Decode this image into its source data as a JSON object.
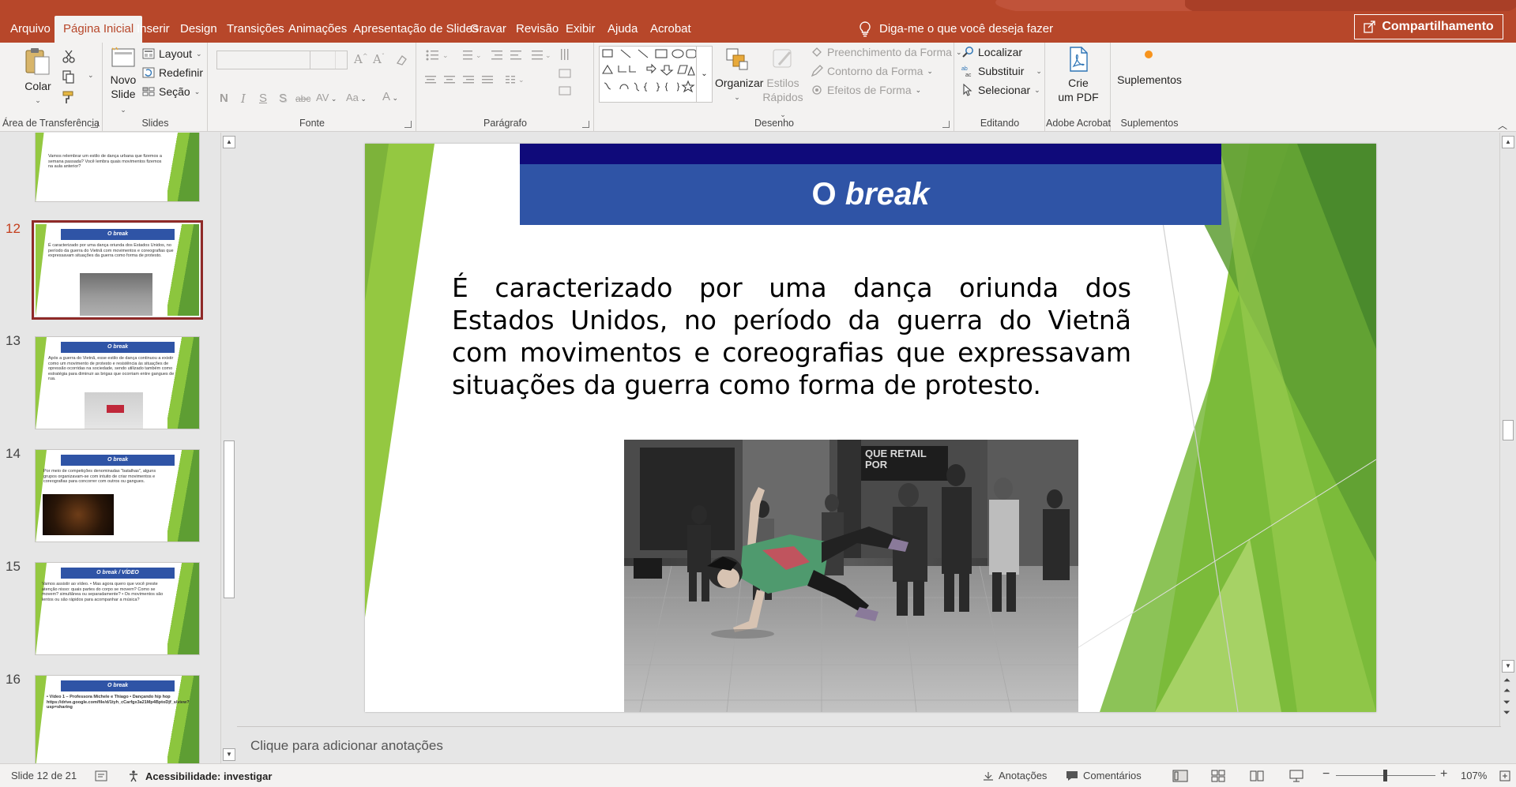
{
  "ribbon_tabs": [
    "Arquivo",
    "Página Inicial",
    "Inserir",
    "Design",
    "Transições",
    "Animações",
    "Apresentação de Slides",
    "Gravar",
    "Revisão",
    "Exibir",
    "Ajuda",
    "Acrobat"
  ],
  "active_tab": "Página Inicial",
  "tell_me": "Diga-me o que você deseja fazer",
  "share_label": "Compartilhamento",
  "groups": {
    "clipboard": {
      "label": "Área de Transferência",
      "paste": "Colar"
    },
    "slides": {
      "label": "Slides",
      "new_slide_line1": "Novo",
      "new_slide_line2": "Slide",
      "layout": "Layout",
      "reset": "Redefinir",
      "section": "Seção"
    },
    "font": {
      "label": "Fonte",
      "bold": "N",
      "italic": "I",
      "underline": "S",
      "shadow": "S",
      "strike": "abc",
      "spacing": "AV",
      "case": "Aa",
      "color": "A"
    },
    "paragraph": {
      "label": "Parágrafo"
    },
    "drawing": {
      "label": "Desenho",
      "organize": "Organizar",
      "quick_styles_line1": "Estilos",
      "quick_styles_line2": "Rápidos",
      "shape_fill": "Preenchimento da Forma",
      "shape_outline": "Contorno da Forma",
      "shape_effects": "Efeitos de Forma"
    },
    "editing": {
      "label": "Editando",
      "find": "Localizar",
      "replace": "Substituir",
      "select": "Selecionar"
    },
    "acrobat": {
      "label": "Adobe Acrobat",
      "create_line1": "Crie",
      "create_line2": "um PDF"
    },
    "addins": {
      "label": "Suplementos",
      "addins": "Suplementos"
    }
  },
  "thumbnails": [
    {
      "num": "",
      "title": "",
      "text": "Vamos relembrar um estilo de dança urbana que fizemos a semana passada? Você lembra quais movimentos fizemos na aula anterior?"
    },
    {
      "num": "12",
      "title": "O break",
      "text": "É caracterizado por uma dança oriunda dos Estados Unidos, no período da guerra do Vietnã com movimentos e coreografias que expressavam situações da guerra como forma de protesto."
    },
    {
      "num": "13",
      "title": "O break",
      "text": "Após a guerra do Vietnã, esse estilo de dança continuou a existir como um movimento de protesto e resistência às situações de opressão ocorridas na sociedade, sendo utilizado também como estratégia para diminuir as brigas que ocorriam entre gangues de rua."
    },
    {
      "num": "14",
      "title": "O break",
      "text": "Por meio de competições denominadas \"batalhas\", alguns grupos organizavam-se com intuito de criar movimentos e coreografias para concorrer com outros ou gangues."
    },
    {
      "num": "15",
      "title": "O break / VÍDEO",
      "text": "Vamos assistir ao vídeo. • Mas agora quero que você preste atenção nisso: quais partes do corpo se movem? Como se movem? simultânea ou separadamente? • Os movimentos são lentos ou são rápidos para acompanhar a música?"
    },
    {
      "num": "16",
      "title": "O break",
      "text": "• Vídeo 1 – Professora Michele e Thiago • Dançando hip hop https://drive.google.com/file/d/1tyh_cCarfgx3a21Mp4BptoDjf_s/view?usp=sharing"
    }
  ],
  "slide": {
    "title_plain": "O ",
    "title_italic": "break",
    "body": "É caracterizado por uma dança oriunda dos Estados Unidos, no período da guerra do Vietnã com movimentos e coreografias que expressavam situações da guerra como forma de protesto.",
    "photo_sign_line1": "QUE RETAIL",
    "photo_sign_line2": "POR"
  },
  "notes_placeholder": "Clique para adicionar anotações",
  "status": {
    "slide_counter": "Slide 12 de 21",
    "accessibility": "Acessibilidade: investigar",
    "notes": "Anotações",
    "comments": "Comentários",
    "zoom": "107%"
  }
}
